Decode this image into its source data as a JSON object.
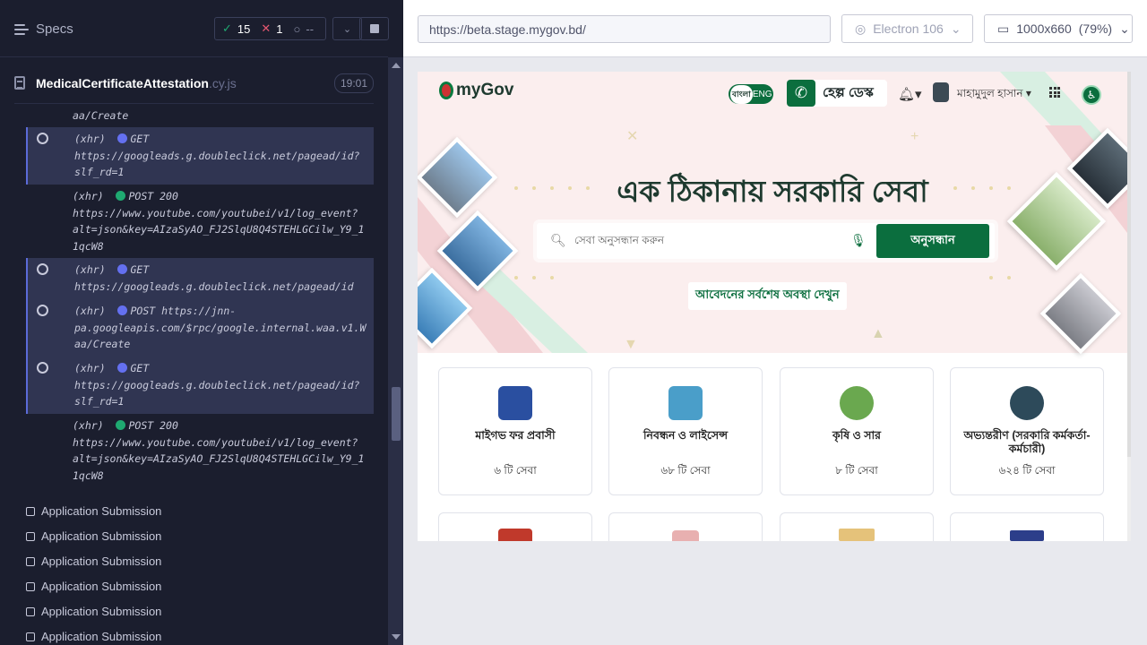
{
  "runner": {
    "specs_label": "Specs",
    "stats": {
      "passed": "15",
      "failed": "1",
      "pending": "--"
    },
    "file": {
      "name": "MedicalCertificateAttestation",
      "ext": ".cy.js",
      "time": "19:01"
    },
    "logs": [
      {
        "text": "aa/Create",
        "active": false
      },
      {
        "kind": "(xhr)",
        "method": "GET",
        "status": "",
        "url": "https://googleads.g.doubleclick.net/pagead/id?\nslf_rd=1",
        "dot": "blue",
        "active": true
      },
      {
        "kind": "(xhr)",
        "method": "POST 200",
        "url": "https://www.youtube.com/youtubei/v1/log_event?\nalt=json&key=AIzaSyAO_FJ2SlqU8Q4STEHLGCilw_Y9_1\n1qcW8",
        "dot": "green",
        "active": false
      },
      {
        "kind": "(xhr)",
        "method": "GET",
        "url": "https://googleads.g.doubleclick.net/pagead/id",
        "dot": "blue",
        "active": true
      },
      {
        "kind": "(xhr)",
        "method": "POST https://jnn-",
        "url": "pa.googleapis.com/$rpc/google.internal.waa.v1.W\naa/Create",
        "dot": "blue",
        "active": true
      },
      {
        "kind": "(xhr)",
        "method": "GET",
        "url": "https://googleads.g.doubleclick.net/pagead/id?\nslf_rd=1",
        "dot": "blue",
        "active": true
      },
      {
        "kind": "(xhr)",
        "method": "POST 200",
        "url": "https://www.youtube.com/youtubei/v1/log_event?\nalt=json&key=AIzaSyAO_FJ2SlqU8Q4STEHLGCilw_Y9_1\n1qcW8",
        "dot": "green",
        "active": false
      }
    ],
    "tests": [
      "Application Submission",
      "Application Submission",
      "Application Submission",
      "Application Submission",
      "Application Submission",
      "Application Submission"
    ]
  },
  "aut_bar": {
    "url": "https://beta.stage.mygov.bd/",
    "browser": "Electron 106",
    "viewport": "1000x660",
    "zoom": "(79%)"
  },
  "site": {
    "logo_text": "myGov",
    "lang_left": "বাংলা",
    "lang_right": "ENG",
    "help_label": "হেল্প ডেস্ক",
    "user_name": "মাহামুদুল হাসান",
    "headline": "এক ঠিকানায় সরকারি সেবা",
    "search_placeholder": "সেবা অনুসন্ধান করুন",
    "search_button": "অনুসন্ধান",
    "status_link": "আবেদনের সর্বশেষ অবস্থা দেখুন",
    "cards": [
      {
        "name": "মাইগভ ফর প্রবাসী",
        "count": "৬ টি সেবা",
        "color": "#2a4fa0"
      },
      {
        "name": "নিবন্ধন ও লাইসেন্স",
        "count": "৬৮ টি সেবা",
        "color": "#4a9ec9"
      },
      {
        "name": "কৃষি ও সার",
        "count": "৮ টি সেবা",
        "color": "#6aa84f"
      },
      {
        "name": "অভ্যন্তরীণ (সরকারি কর্মকর্তা-কর্মচারী)",
        "count": "৬২৪ টি সেবা",
        "color": "#2d4a5a"
      }
    ]
  }
}
